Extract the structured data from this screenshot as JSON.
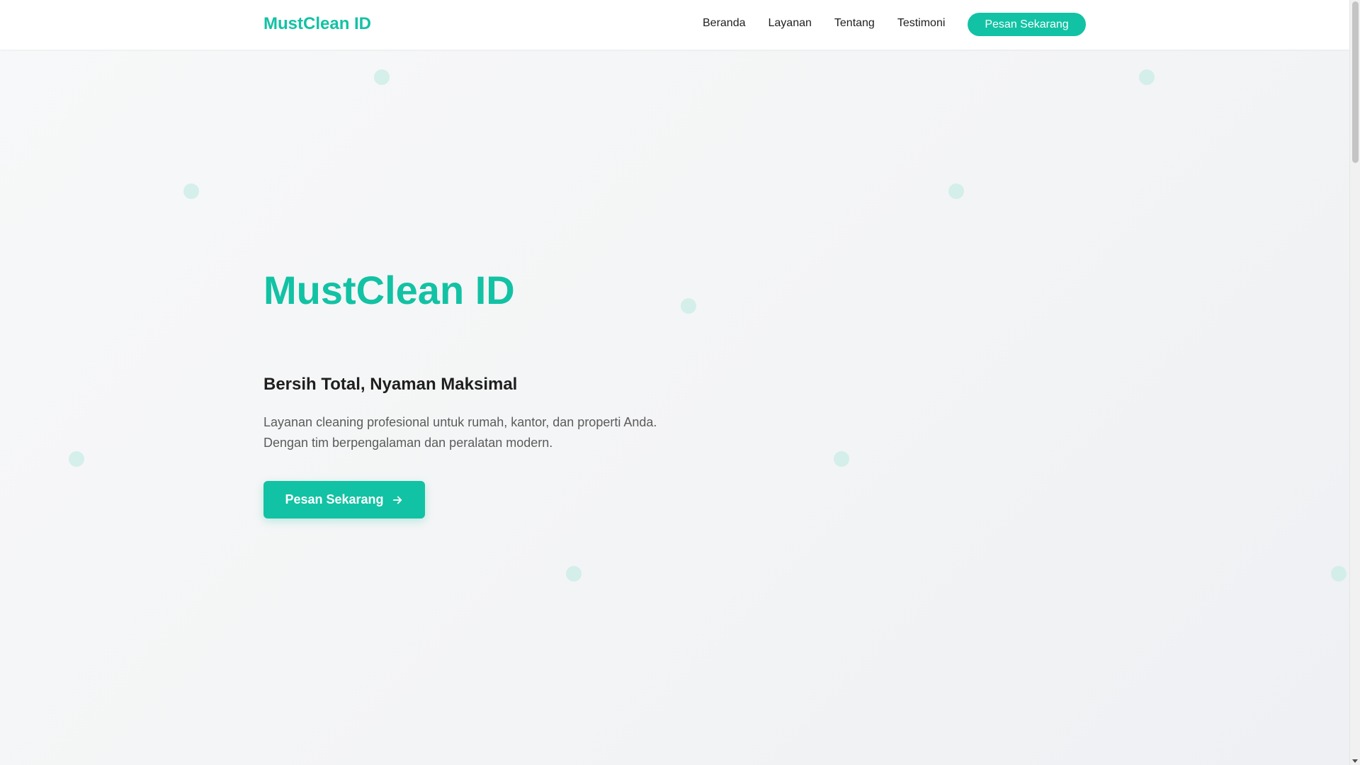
{
  "navbar": {
    "brand": "MustClean ID",
    "links": [
      {
        "label": "Beranda"
      },
      {
        "label": "Layanan"
      },
      {
        "label": "Tentang"
      },
      {
        "label": "Testimoni"
      }
    ],
    "cta_label": "Pesan Sekarang"
  },
  "hero": {
    "title": "MustClean ID",
    "subtitle": "Bersih Total, Nyaman Maksimal",
    "description_line1": "Layanan cleaning profesional untuk rumah, kantor, dan properti Anda.",
    "description_line2": "Dengan tim berpengalaman dan peralatan modern.",
    "cta_label": "Pesan Sekarang",
    "cta_icon": "arrow-right-icon"
  },
  "colors": {
    "brand": "#12c2a4",
    "text_dark": "#1f1f1f",
    "text_muted": "#5b5b5b",
    "hero_background": "#f4f5f6",
    "decor_dot": "#c9ece5"
  }
}
